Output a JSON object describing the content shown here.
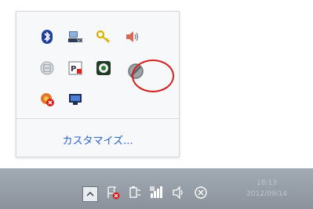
{
  "popup": {
    "customize_label": "カスタマイズ...",
    "icons": [
      "bluetooth-icon",
      "network-drive-icon",
      "key-icon",
      "volume-speaker-icon",
      "document-tool-icon",
      "pdf-tool-icon",
      "media-icon",
      "disabled-app-icon",
      "app-error-icon",
      "display-monitor-icon"
    ]
  },
  "taskbar": {
    "clock_time": "18:13",
    "clock_date": "2012/09/14"
  },
  "colors": {
    "highlight": "#d21f1f",
    "link": "#2a64c8"
  }
}
